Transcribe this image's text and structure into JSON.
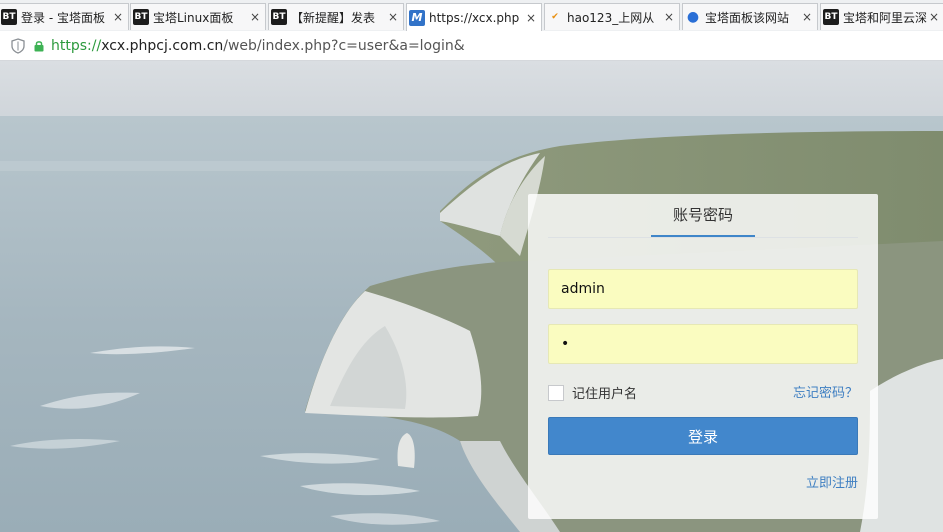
{
  "tabs": [
    {
      "favicon": "BT",
      "title": "登录 - 宝塔面板"
    },
    {
      "favicon": "BT",
      "title": "宝塔Linux面板"
    },
    {
      "favicon": "BT",
      "title": "【新提醒】发表"
    },
    {
      "favicon": "M",
      "title": "https://xcx.php"
    },
    {
      "favicon": "hao",
      "title": "hao123_上网从"
    },
    {
      "favicon": "paw",
      "title": "宝塔面板该网站"
    },
    {
      "favicon": "BT",
      "title": "宝塔和阿里云深"
    }
  ],
  "address": {
    "scheme": "https://",
    "host": "xcx.phpcj.com.cn",
    "path": "/web/index.php?c=user&a=login&"
  },
  "login": {
    "title": "账号密码",
    "username_value": "admin",
    "password_value": "•",
    "remember_label": "记住用户名",
    "forgot_label": "忘记密码？",
    "submit_label": "登录",
    "register_label": "立即注册"
  },
  "colors": {
    "accent": "#4287cc",
    "link": "#3f7fc2",
    "autofill": "#fafcc0"
  },
  "icons": {
    "shield": "shield-icon",
    "lock": "lock-icon",
    "close": "close-icon"
  }
}
